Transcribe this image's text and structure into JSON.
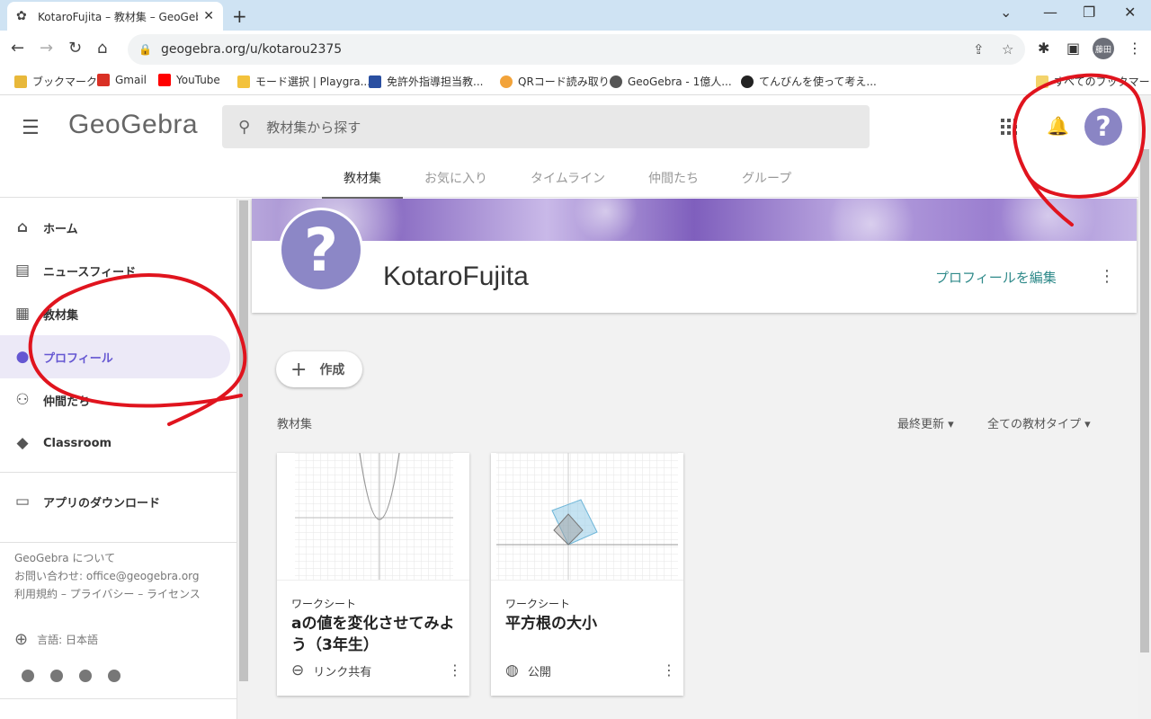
{
  "browser": {
    "tab_title": "KotaroFujita – 教材集 – GeoGebra",
    "tab_close": "✕",
    "new_tab": "+",
    "url": "geogebra.org/u/kotarou2375",
    "profile_initial": "藤田",
    "window_controls": {
      "collapse": "⌄",
      "minimize": "—",
      "restore": "❐",
      "close": "✕"
    },
    "bookmarks": [
      {
        "label": "ブックマーク",
        "color": "#e8b83a"
      },
      {
        "label": "Gmail",
        "color": "#d93025"
      },
      {
        "label": "YouTube",
        "color": "#ff0000"
      },
      {
        "label": "モード選択 | Playgra...",
        "color": "#f3c23c"
      },
      {
        "label": "免許外指導担当教...",
        "color": "#2a4fa1"
      },
      {
        "label": "QRコード読み取り",
        "color": "#f2a33a"
      },
      {
        "label": "GeoGebra - 1億人...",
        "color": "#555555"
      },
      {
        "label": "てんびんを使って考え...",
        "color": "#222222"
      },
      {
        "label": "すべてのブックマーク",
        "color": "#f3d36b"
      }
    ]
  },
  "header": {
    "logo": "GeoGebra",
    "search_placeholder": "教材集から探す",
    "help_avatar": "?",
    "subtabs": [
      "教材集",
      "お気に入り",
      "タイムライン",
      "仲間たち",
      "グループ"
    ]
  },
  "sidebar": {
    "items": [
      {
        "label": "ホーム",
        "icon": "home-icon"
      },
      {
        "label": "ニュースフィード",
        "icon": "newsfeed-icon"
      },
      {
        "label": "教材集",
        "icon": "document-icon"
      },
      {
        "label": "プロフィール",
        "icon": "person-icon"
      },
      {
        "label": "仲間たち",
        "icon": "people-icon"
      },
      {
        "label": "Classroom",
        "icon": "classroom-icon"
      }
    ],
    "download": "アプリのダウンロード",
    "footer": {
      "about": "GeoGebra について",
      "contact": "お問い合わせ: office@geogebra.org",
      "legal": "利用規約 – プライバシー – ライセンス"
    },
    "language": "言語: 日本語"
  },
  "profile": {
    "avatar": "?",
    "name": "KotaroFujita",
    "edit_label": "プロフィールを編集"
  },
  "main": {
    "create_label": "作成",
    "materials_label": "教材集",
    "sort_label": "最終更新",
    "type_filter": "全ての教材タイプ",
    "cards": [
      {
        "type": "ワークシート",
        "title": "aの値を変化させてみよう（3年生）",
        "visibility": "リンク共有",
        "visibility_icon": "link-icon"
      },
      {
        "type": "ワークシート",
        "title": "平方根の大小",
        "visibility": "公開",
        "visibility_icon": "globe-icon"
      }
    ]
  },
  "colors": {
    "accent": "#6557d2",
    "teal": "#2f8a8a",
    "annotation": "#e0141e"
  }
}
